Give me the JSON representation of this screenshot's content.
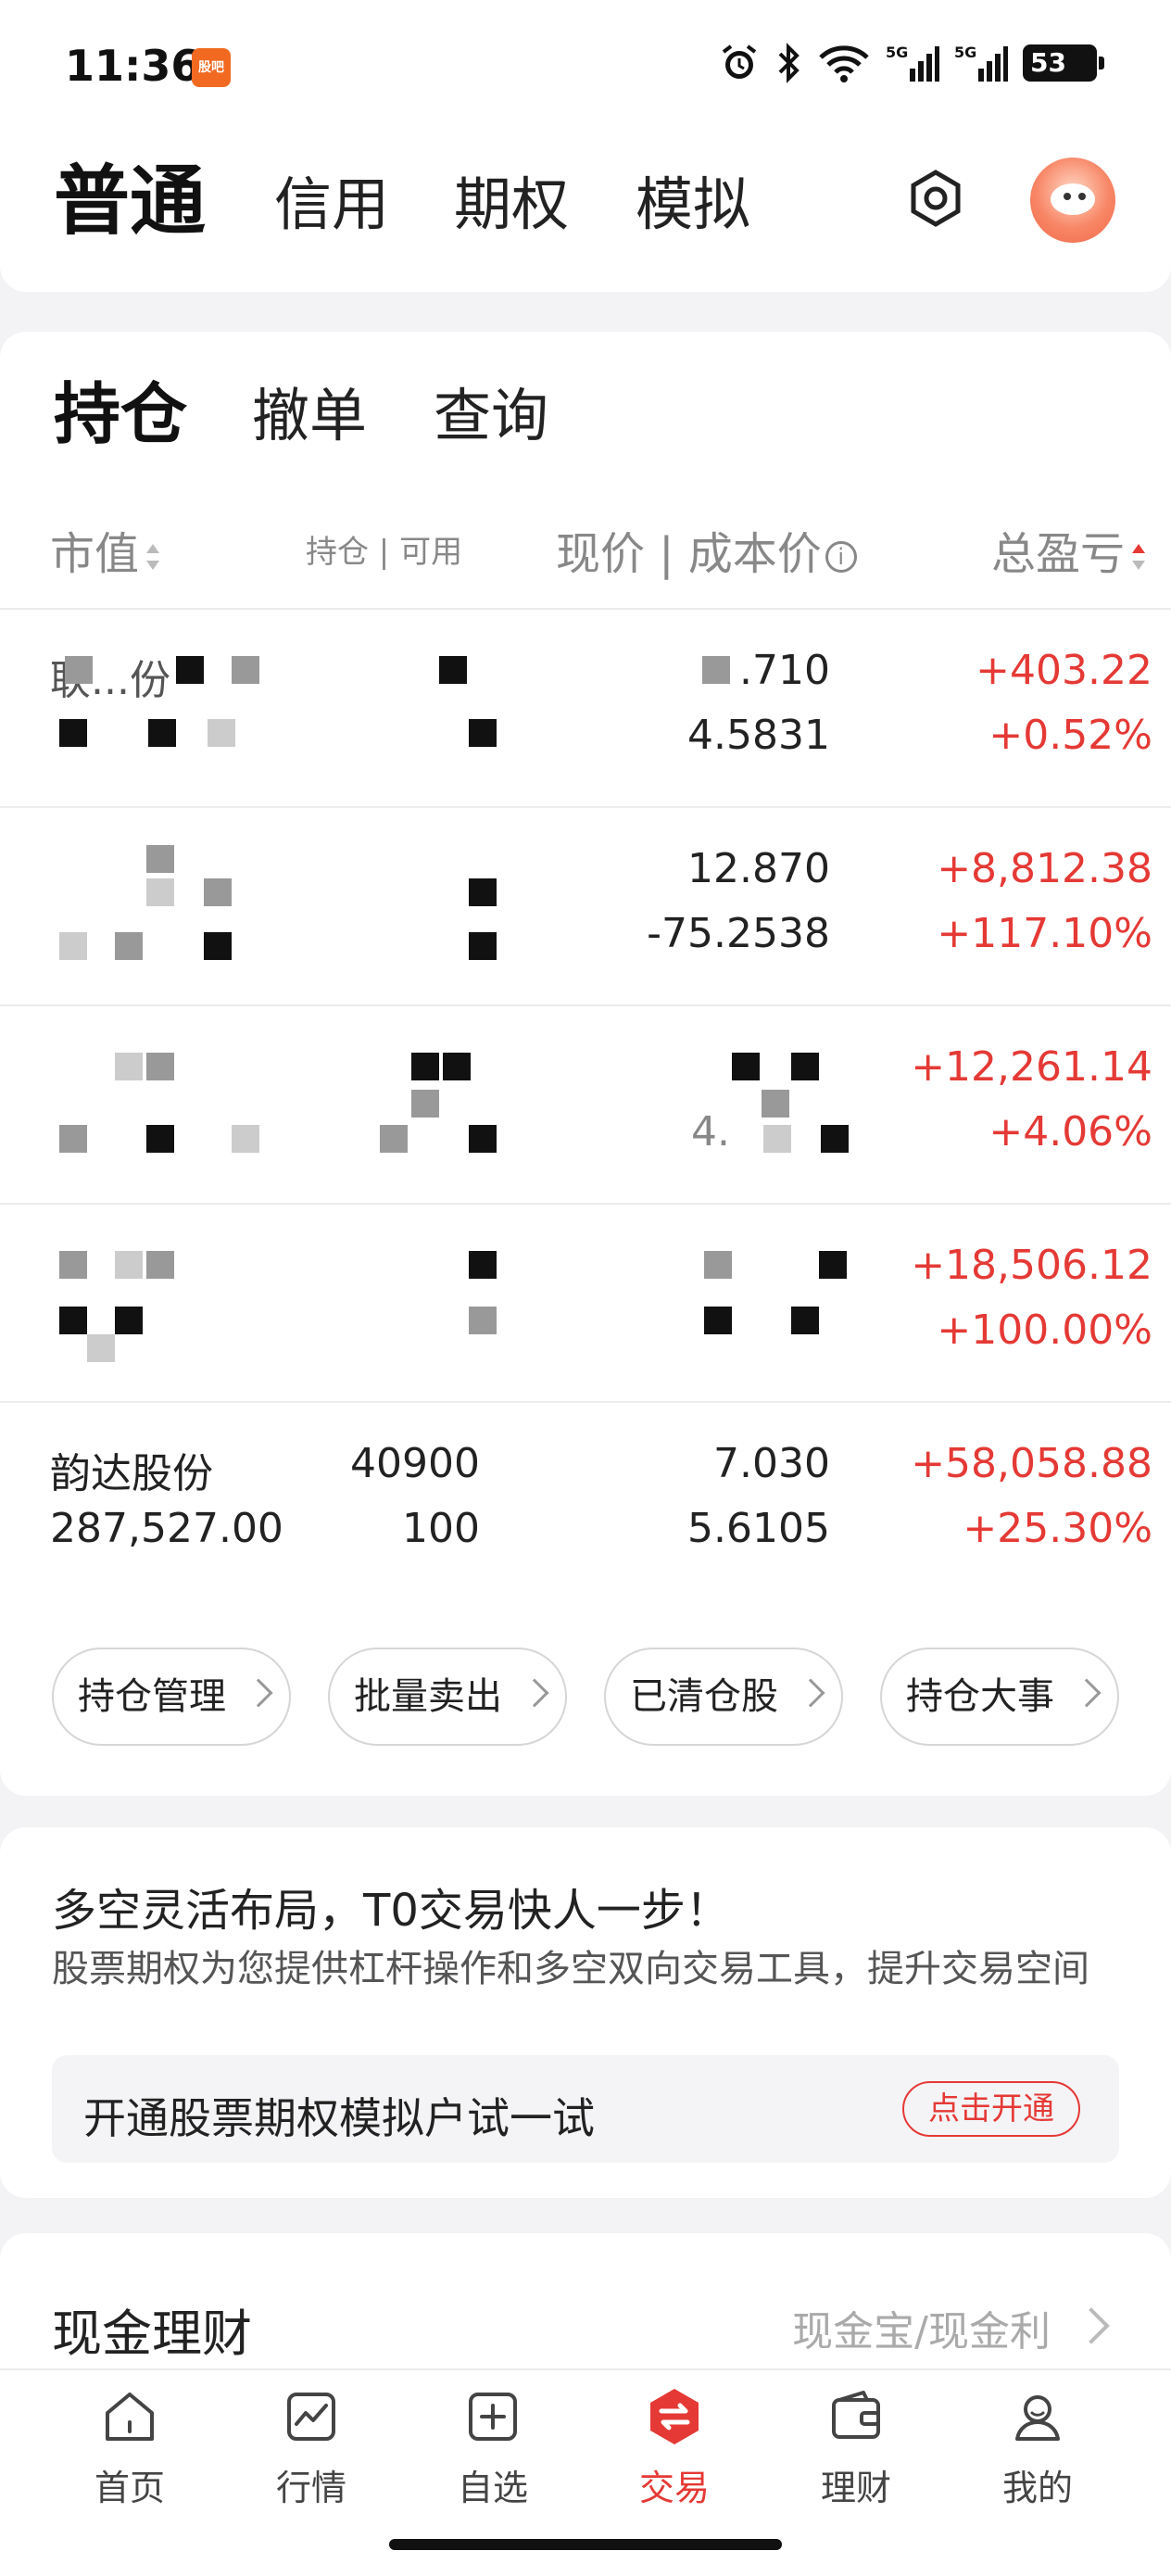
{
  "status_bar": {
    "time": "11:36",
    "app_badge": "股吧",
    "battery": "53"
  },
  "account_tabs": {
    "active": "普通",
    "others": [
      "信用",
      "期权",
      "模拟"
    ]
  },
  "sub_tabs": {
    "active": "持仓",
    "others": [
      "撤单",
      "查询"
    ]
  },
  "columns": {
    "market_value": "市值",
    "position": "持仓",
    "available": "可用",
    "price": "现价",
    "cost": "成本价",
    "pnl": "总盈亏"
  },
  "holdings": [
    {
      "name": "联...份",
      "market_value": "",
      "position": "",
      "available": "",
      "price": ".710",
      "cost": "4.5831",
      "pnl": "+403.22",
      "pnl_pct": "+0.52%"
    },
    {
      "name": "",
      "market_value": "",
      "position": "",
      "available": "",
      "price": "12.870",
      "cost": "-75.2538",
      "pnl": "+8,812.38",
      "pnl_pct": "+117.10%"
    },
    {
      "name": "",
      "market_value": "",
      "position": "",
      "available": "",
      "price": "",
      "cost": "4.",
      "pnl": "+12,261.14",
      "pnl_pct": "+4.06%"
    },
    {
      "name": "",
      "market_value": "",
      "position": "",
      "available": "",
      "price": "",
      "cost": "",
      "pnl": "+18,506.12",
      "pnl_pct": "+100.00%"
    },
    {
      "name": "韵达股份",
      "market_value": "287,527.00",
      "position": "40900",
      "available": "100",
      "price": "7.030",
      "cost": "5.6105",
      "pnl": "+58,058.88",
      "pnl_pct": "+25.30%"
    }
  ],
  "actions": [
    "持仓管理",
    "批量卖出",
    "已清仓股",
    "持仓大事"
  ],
  "promo": {
    "title": "多空灵活布局，T0交易快人一步！",
    "desc": "股票期权为您提供杠杆操作和多空双向交易工具，提升交易空间",
    "box_text": "开通股票期权模拟户试一试",
    "button": "点击开通"
  },
  "cash": {
    "title": "现金理财",
    "sub": "现金宝/现金利"
  },
  "nav": [
    {
      "label": "首页",
      "icon": "home-icon"
    },
    {
      "label": "行情",
      "icon": "chart-icon"
    },
    {
      "label": "自选",
      "icon": "add-square-icon"
    },
    {
      "label": "交易",
      "icon": "trade-icon"
    },
    {
      "label": "理财",
      "icon": "wallet-icon"
    },
    {
      "label": "我的",
      "icon": "user-icon"
    }
  ],
  "colors": {
    "accent": "#e53935",
    "text": "#222222",
    "muted": "#888888"
  }
}
